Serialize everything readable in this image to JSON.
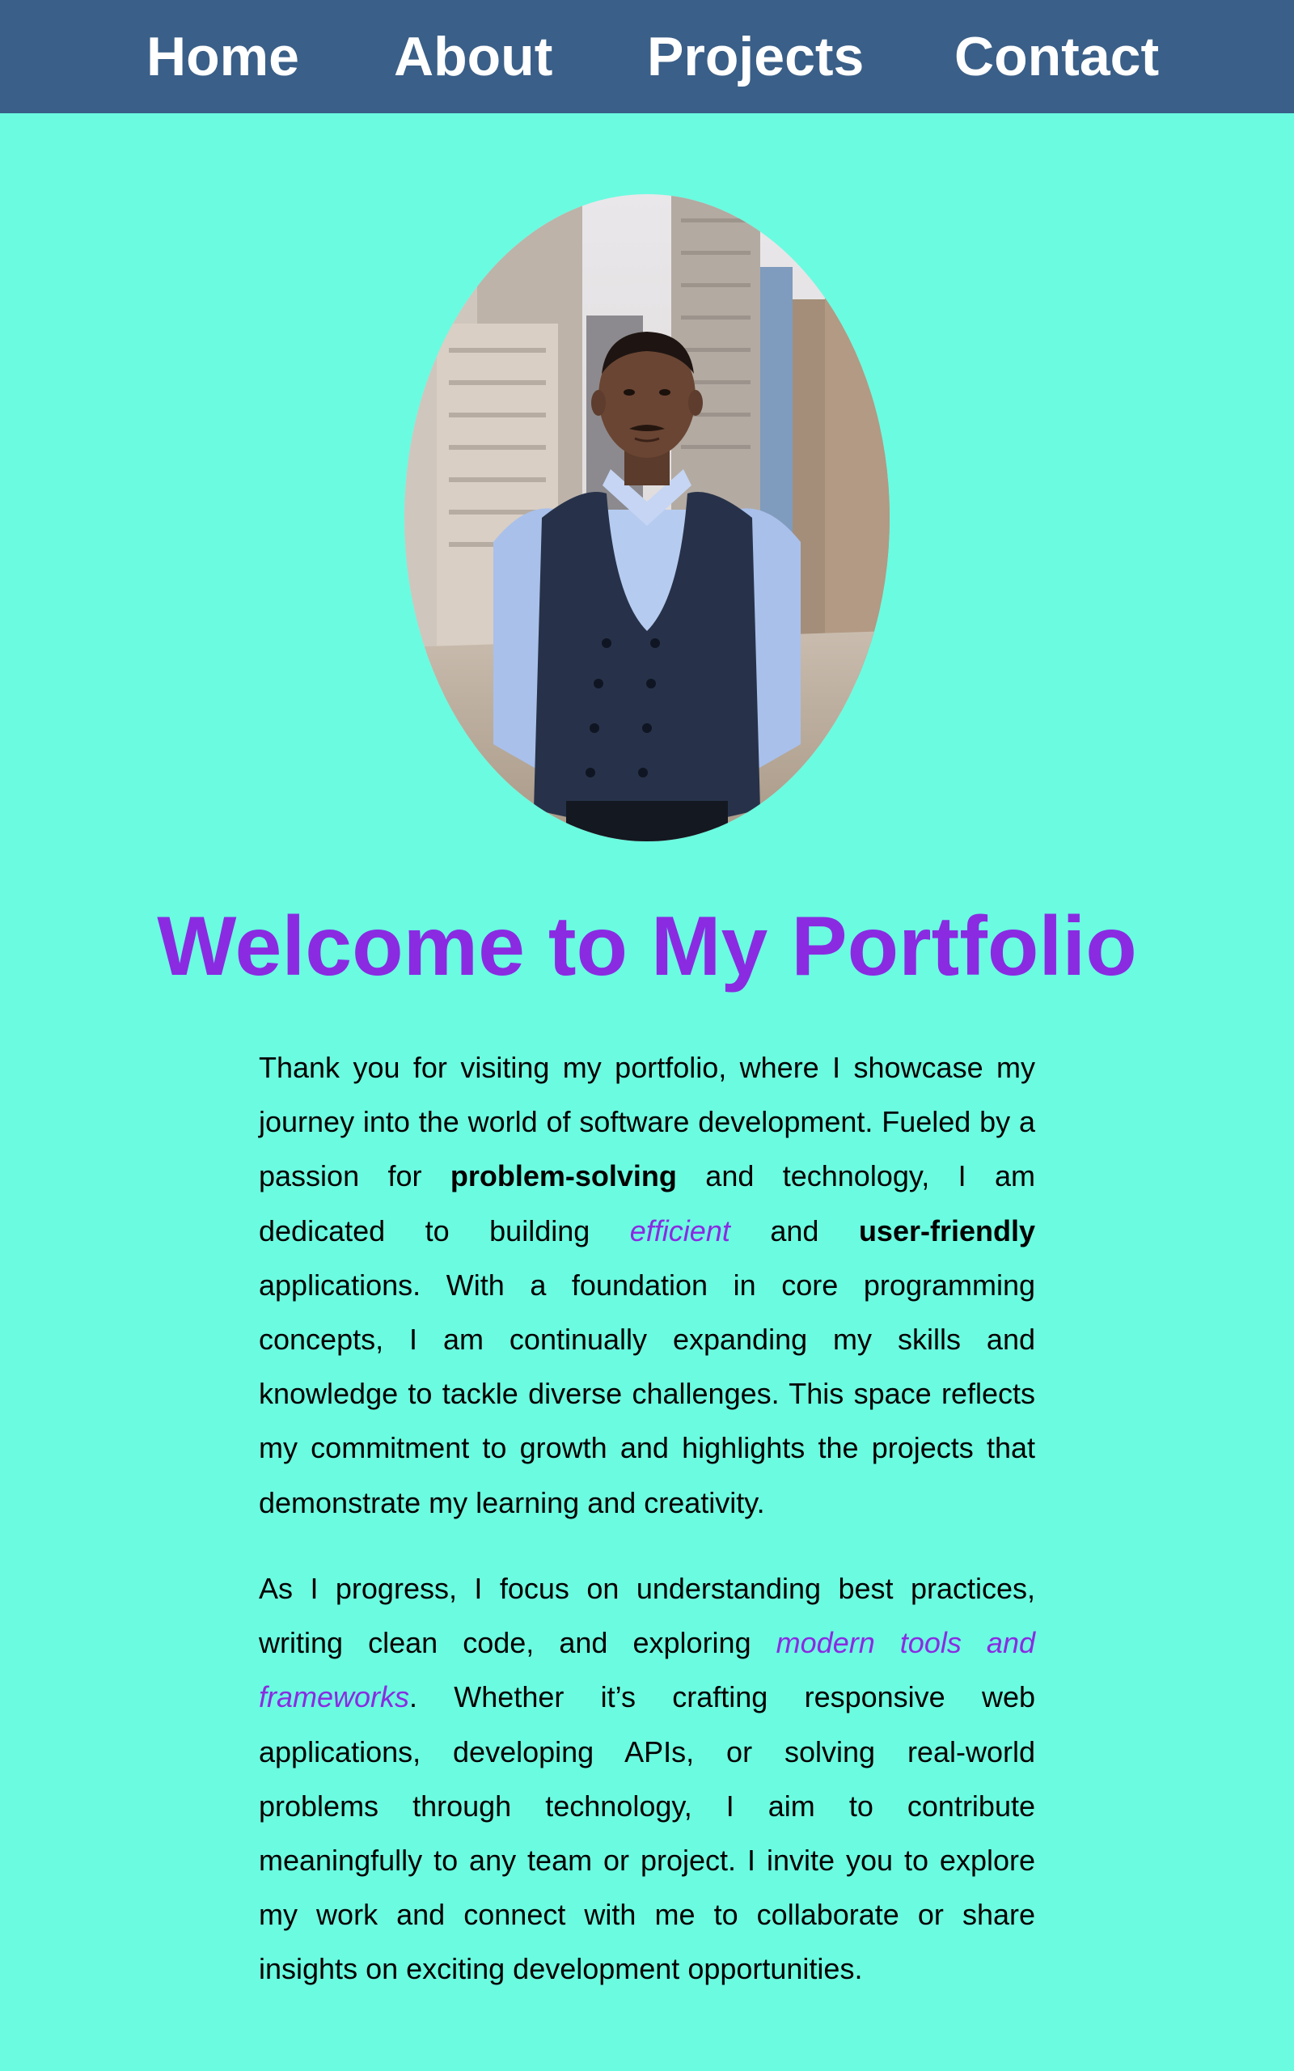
{
  "nav": {
    "home": "Home",
    "about": "About",
    "projects": "Projects",
    "contact": "Contact"
  },
  "hero": {
    "title": "Welcome to My Portfolio"
  },
  "intro": {
    "p1_a": "Thank you for visiting my portfolio, where I showcase my journey into the world of software development. Fueled by a passion for ",
    "p1_b": "problem-solving",
    "p1_c": " and technology, I am dedicated to building ",
    "p1_d": "efficient",
    "p1_e": " and ",
    "p1_f": "user-friendly",
    "p1_g": " applications. With a foundation in core programming concepts, I am continually expanding my skills and knowledge to tackle diverse challenges. This space reflects my commitment to growth and highlights the projects that demonstrate my learning and creativity.",
    "p2_a": "As I progress, I focus on understanding best practices, writing clean code, and exploring ",
    "p2_b": "modern tools and frameworks",
    "p2_c": ". Whether it’s crafting responsive web applications, developing APIs, or solving real-world problems through technology, I aim to contribute meaningfully to any team or project. I invite you to explore my work and connect with me to collaborate or share insights on exciting development opportunities."
  },
  "colors": {
    "background": "#6bfbe0",
    "navbar": "#3a5f88",
    "accent": "#8a2be2"
  }
}
